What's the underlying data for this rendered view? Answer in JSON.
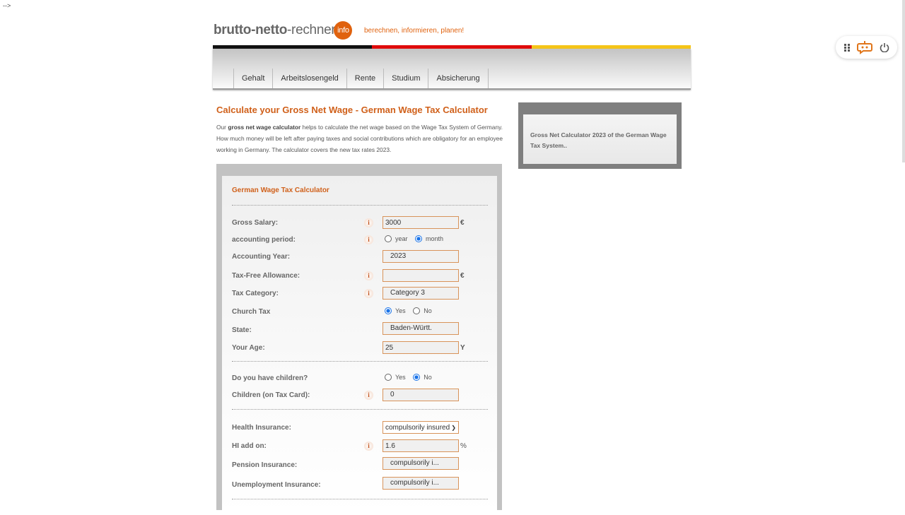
{
  "stray_text": "-->",
  "logo": {
    "part1": "brutto-netto",
    "part2": "-rechner",
    "badge": "info",
    "slogan": "berechnen, informieren, planen!"
  },
  "flag_colors": [
    "#111111",
    "#e00a0a",
    "#f5c518"
  ],
  "nav": [
    "Gehalt",
    "Arbeitslosengeld",
    "Rente",
    "Studium",
    "Absicherung"
  ],
  "heading": "Calculate your Gross Net Wage - German Wage Tax Calculator",
  "intro": {
    "pre": "Our ",
    "bold": "gross net wage calculator",
    "post": " helps to calculate the net wage based on the Wage Tax System of Germany. How much money will be left after paying taxes and social contributions which are obligatory for an employee working in Germany. The calculator covers the new tax rates 2023."
  },
  "sidebar_text": "Gross Net Calculator 2023 of the German Wage Tax System..",
  "calc": {
    "title": "German Wage Tax Calculator",
    "gross_salary": {
      "label": "Gross Salary:",
      "value": "3000",
      "unit": "€"
    },
    "period": {
      "label": "accounting period:",
      "options": [
        "year",
        "month"
      ],
      "selected": "month"
    },
    "year": {
      "label": "Accounting Year:",
      "value": "2023"
    },
    "allowance": {
      "label": "Tax-Free Allowance:",
      "value": "",
      "unit": "€"
    },
    "tax_category": {
      "label": "Tax Category:",
      "value": "Category 3"
    },
    "church": {
      "label": "Church Tax",
      "options": [
        "Yes",
        "No"
      ],
      "selected": "Yes"
    },
    "state": {
      "label": "State:",
      "value": "Baden-Württ."
    },
    "age": {
      "label": "Your Age:",
      "value": "25",
      "unit": "Y"
    },
    "children": {
      "label": "Do you have children?",
      "options": [
        "Yes",
        "No"
      ],
      "selected": "No"
    },
    "children_card": {
      "label": "Children (on Tax Card):",
      "value": "0"
    },
    "health": {
      "label": "Health Insurance:",
      "value": "compulsorily insured"
    },
    "hi_addon": {
      "label": "HI add on:",
      "value": "1.6",
      "unit": "%"
    },
    "pension": {
      "label": "Pension Insurance:",
      "value": "compulsorily i..."
    },
    "unemployment": {
      "label": "Unemployment Insurance:",
      "value": "compulsorily i..."
    }
  },
  "accent": "#d0601a",
  "tray_icons": [
    "apps-grid-icon",
    "chat-bot-icon",
    "power-icon"
  ]
}
